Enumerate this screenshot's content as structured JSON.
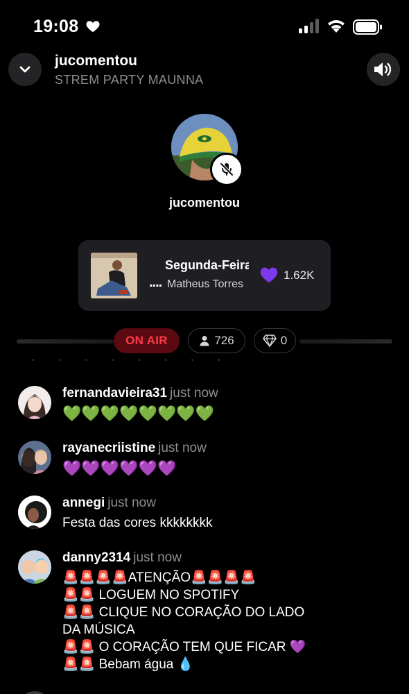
{
  "status_bar": {
    "time": "19:08"
  },
  "header": {
    "title": "jucomentou",
    "subtitle": "STREM PARTY MAUNNA"
  },
  "host": {
    "name": "jucomentou",
    "mic": "muted"
  },
  "song": {
    "title": "Segunda-Feira",
    "artist": "Matheus Torres",
    "dots": "....",
    "likes": "1.62K"
  },
  "stats": {
    "on_air": "ON AIR",
    "viewers": "726",
    "gems": "0"
  },
  "colors": {
    "accent_purple": "#7c3aed",
    "on_air_red": "#ff3a4a",
    "card_bg": "#1f1f23"
  },
  "comments": [
    {
      "user": "fernandavieira31",
      "time": "just now",
      "lines": [
        "💚💚💚💚💚💚💚💚"
      ]
    },
    {
      "user": "rayanecriistine",
      "time": "just now",
      "lines": [
        "💜💜💜💜💜💜"
      ]
    },
    {
      "user": "annegi",
      "time": "just now",
      "lines": [
        "Festa das cores kkkkkkkk"
      ]
    },
    {
      "user": "danny2314",
      "time": "just now",
      "lines": [
        "🚨🚨🚨🚨ATENÇÃO🚨🚨🚨🚨",
        "🚨🚨 LOGUEM NO SPOTIFY",
        "🚨🚨 CLIQUE NO CORAÇÃO DO LADO",
        "DA MÚSICA",
        "🚨🚨 O CORAÇÃO TEM QUE FICAR 💜",
        "🚨🚨 Bebam água 💧"
      ]
    }
  ]
}
